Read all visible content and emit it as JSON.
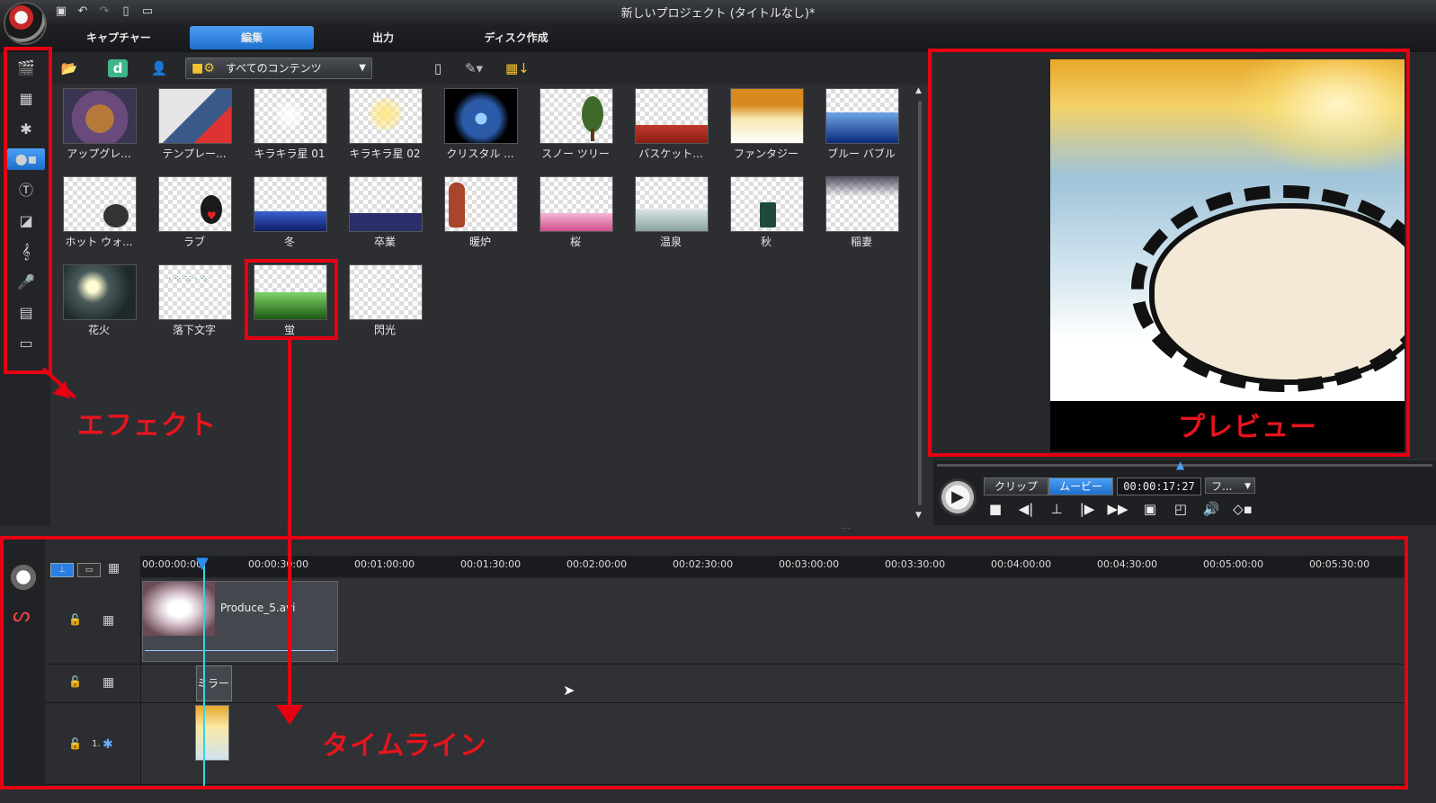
{
  "window": {
    "title": "新しいプロジェクト (タイトルなし)*"
  },
  "quickbar": {
    "icons": [
      "save-icon",
      "undo-icon",
      "redo-icon",
      "new-file-icon",
      "open-folder-icon"
    ]
  },
  "tabs": [
    {
      "label": "キャプチャー",
      "active": false
    },
    {
      "label": "編集",
      "active": true
    },
    {
      "label": "出力",
      "active": false
    },
    {
      "label": "ディスク作成",
      "active": false
    }
  ],
  "rail": {
    "items": [
      "media-room-icon",
      "fx-room-icon",
      "pip-room-icon",
      "particle-room-icon",
      "title-room-icon",
      "transition-room-icon",
      "audio-mixing-icon",
      "voiceover-icon",
      "chapter-room-icon",
      "subtitle-room-icon"
    ],
    "active_index": 3
  },
  "library": {
    "filter": "すべてのコンテンツ",
    "items": [
      {
        "label": "アップグレ..."
      },
      {
        "label": "テンプレー..."
      },
      {
        "label": "キラキラ星 01"
      },
      {
        "label": "キラキラ星 02"
      },
      {
        "label": "クリスタル ..."
      },
      {
        "label": "スノー ツリー"
      },
      {
        "label": "バスケット..."
      },
      {
        "label": "ファンタジー"
      },
      {
        "label": "ブルー バブル"
      },
      {
        "label": "ホット ウォ..."
      },
      {
        "label": "ラブ"
      },
      {
        "label": "冬"
      },
      {
        "label": "卒業"
      },
      {
        "label": "暖炉"
      },
      {
        "label": "桜"
      },
      {
        "label": "温泉"
      },
      {
        "label": "秋"
      },
      {
        "label": "稲妻"
      },
      {
        "label": "花火"
      },
      {
        "label": "落下文字"
      },
      {
        "label": "蛍"
      },
      {
        "label": "閃光"
      }
    ]
  },
  "transport": {
    "clip_label": "クリップ",
    "movie_label": "ムービー",
    "timecode": "00:00:17:27",
    "quality_label": "フ..."
  },
  "timeline": {
    "ticks": [
      "00:00:00:00",
      "00:00:30:00",
      "00:01:00:00",
      "00:01:30:00",
      "00:02:00:00",
      "00:02:30:00",
      "00:03:00:00",
      "00:03:30:00",
      "00:04:00:00",
      "00:04:30:00",
      "00:05:00:00",
      "00:05:30:00"
    ],
    "video_clip_name": "Produce_5.avi",
    "fx_clip_name": "ミラー",
    "pip_track_num": "1."
  },
  "annotations": {
    "effect": "エフェクト",
    "preview": "プレビュー",
    "timeline": "タイムライン"
  },
  "colors": {
    "accent": "#2a7fe0",
    "annotation_red": "#e60012"
  }
}
